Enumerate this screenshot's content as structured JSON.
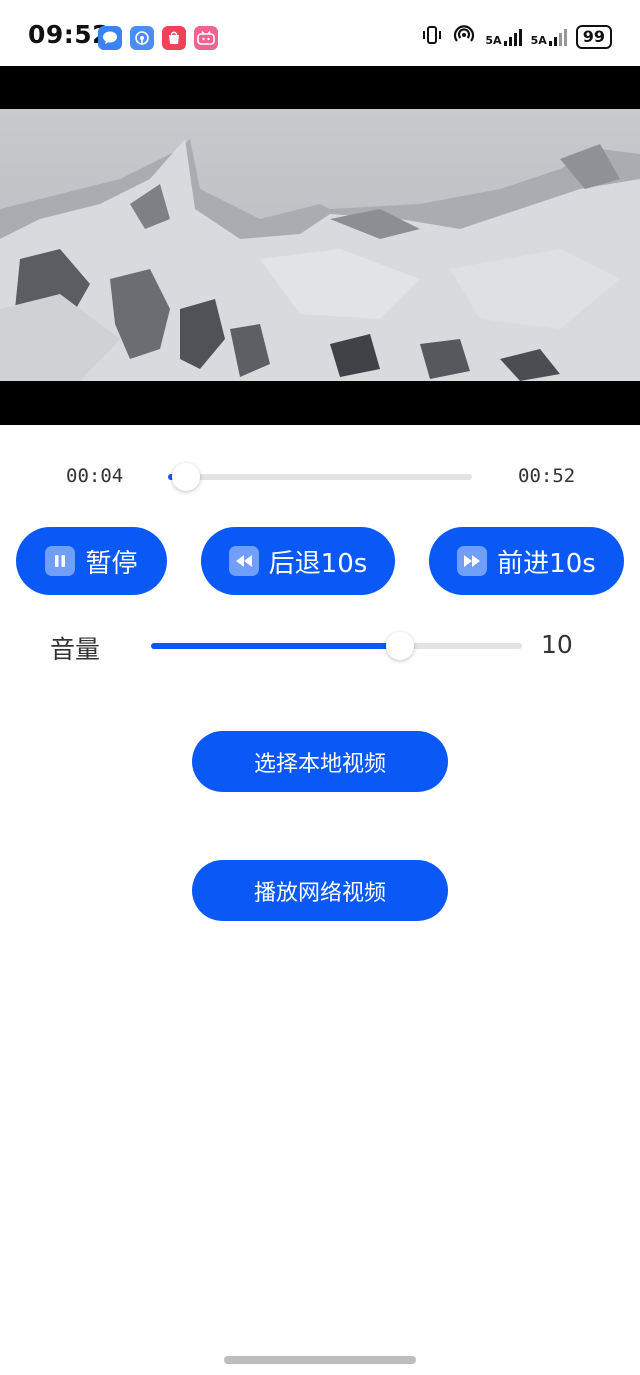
{
  "status_bar": {
    "time": "09:52",
    "network_label_1": "5A",
    "network_label_2": "5A",
    "battery": "99",
    "notification_icons": [
      "message-icon",
      "podcast-icon",
      "shopping-icon",
      "bilibili-icon"
    ]
  },
  "player": {
    "current_time": "00:04",
    "total_time": "00:52",
    "progress_fraction": 0.06
  },
  "controls": {
    "pause_label": "暂停",
    "rewind_label": "后退10s",
    "forward_label": "前进10s"
  },
  "volume": {
    "label": "音量",
    "value": "10",
    "level_fraction": 0.67
  },
  "actions": {
    "local_video_label": "选择本地视频",
    "network_video_label": "播放网络视频"
  },
  "colors": {
    "accent": "#0a59f7",
    "track": "#e3e3e3"
  }
}
